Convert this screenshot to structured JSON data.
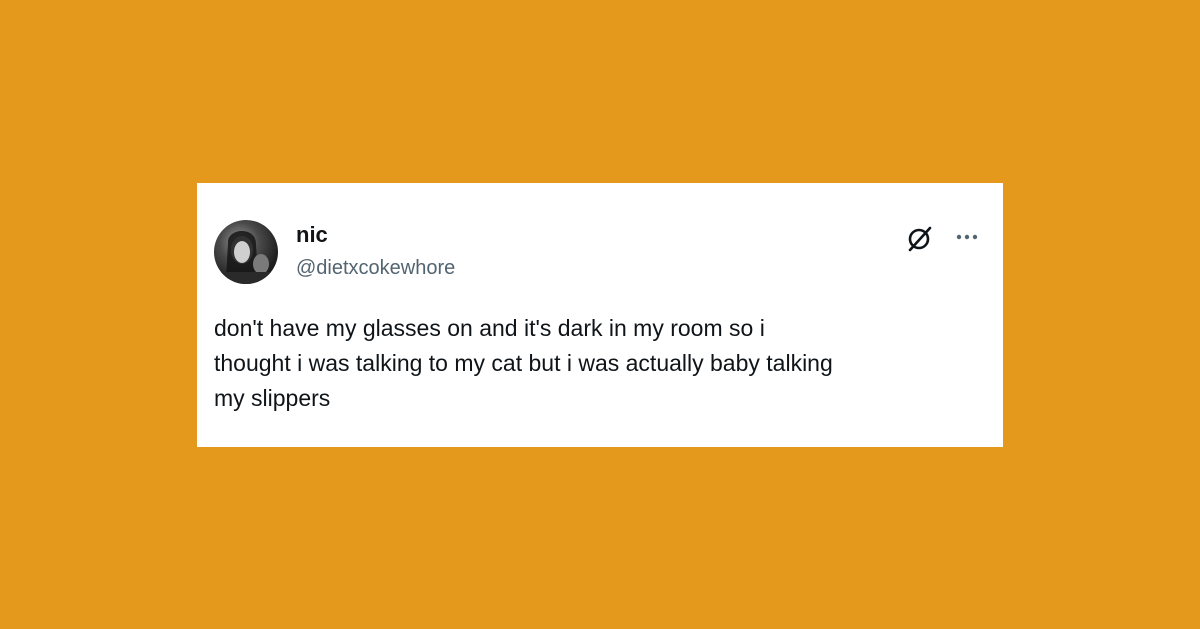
{
  "tweet": {
    "display_name": "nic",
    "handle": "@dietxcokewhore",
    "text": "don't have my glasses on and it's dark in my room so i\nthought i was talking to my cat but i was actually baby talking\nmy slippers"
  },
  "icons": {
    "avatar": "profile-photo",
    "grok": "grok-icon",
    "more": "more-options-icon"
  },
  "colors": {
    "background": "#E4981C",
    "card": "#FFFFFF",
    "text_primary": "#0F1419",
    "text_secondary": "#536471"
  }
}
